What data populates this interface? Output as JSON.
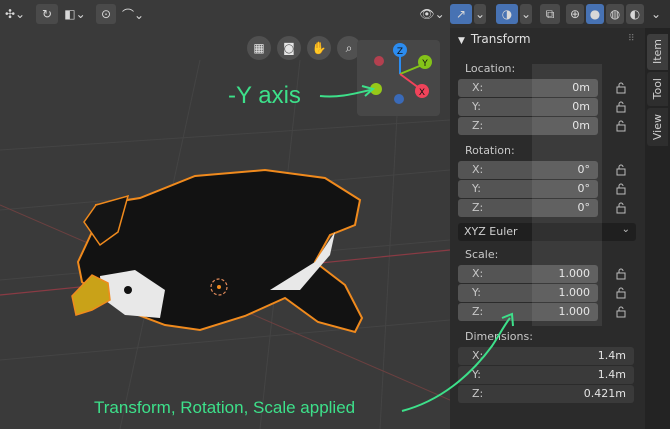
{
  "panel": {
    "title": "Transform",
    "location_label": "Location:",
    "location": [
      {
        "axis": "X:",
        "value": "0m"
      },
      {
        "axis": "Y:",
        "value": "0m"
      },
      {
        "axis": "Z:",
        "value": "0m"
      }
    ],
    "rotation_label": "Rotation:",
    "rotation": [
      {
        "axis": "X:",
        "value": "0°"
      },
      {
        "axis": "Y:",
        "value": "0°"
      },
      {
        "axis": "Z:",
        "value": "0°"
      }
    ],
    "rotation_mode": "XYZ Euler",
    "scale_label": "Scale:",
    "scale": [
      {
        "axis": "X:",
        "value": "1.000"
      },
      {
        "axis": "Y:",
        "value": "1.000"
      },
      {
        "axis": "Z:",
        "value": "1.000"
      }
    ],
    "dimensions_label": "Dimensions:",
    "dimensions": [
      {
        "axis": "X:",
        "value": "1.4m"
      },
      {
        "axis": "Y:",
        "value": "1.4m"
      },
      {
        "axis": "Z:",
        "value": "0.421m"
      }
    ]
  },
  "tabs": [
    "Item",
    "Tool",
    "View"
  ],
  "gizmo": {
    "z": "Z",
    "y": "Y",
    "x": "X"
  },
  "annotations": {
    "axis": "-Y axis",
    "applied": "Transform, Rotation, Scale applied"
  },
  "colors": {
    "accent": "#4772b3",
    "annotation": "#3de08a",
    "selection_outline": "#f08a1d",
    "axis_x": "#f0435a",
    "axis_y": "#84c319",
    "axis_z": "#2b8cf0"
  },
  "icons": [
    "orbit-icon",
    "snap-icon",
    "proportional-icon",
    "falloff-icon",
    "visibility-icon",
    "gizmo-icon",
    "overlay-icon",
    "xray-icon",
    "wireframe-shading-icon",
    "solid-shading-icon",
    "material-shading-icon",
    "rendered-shading-icon",
    "grid-view-icon",
    "camera-icon",
    "hand-icon",
    "zoom-icon",
    "lock-icon"
  ]
}
